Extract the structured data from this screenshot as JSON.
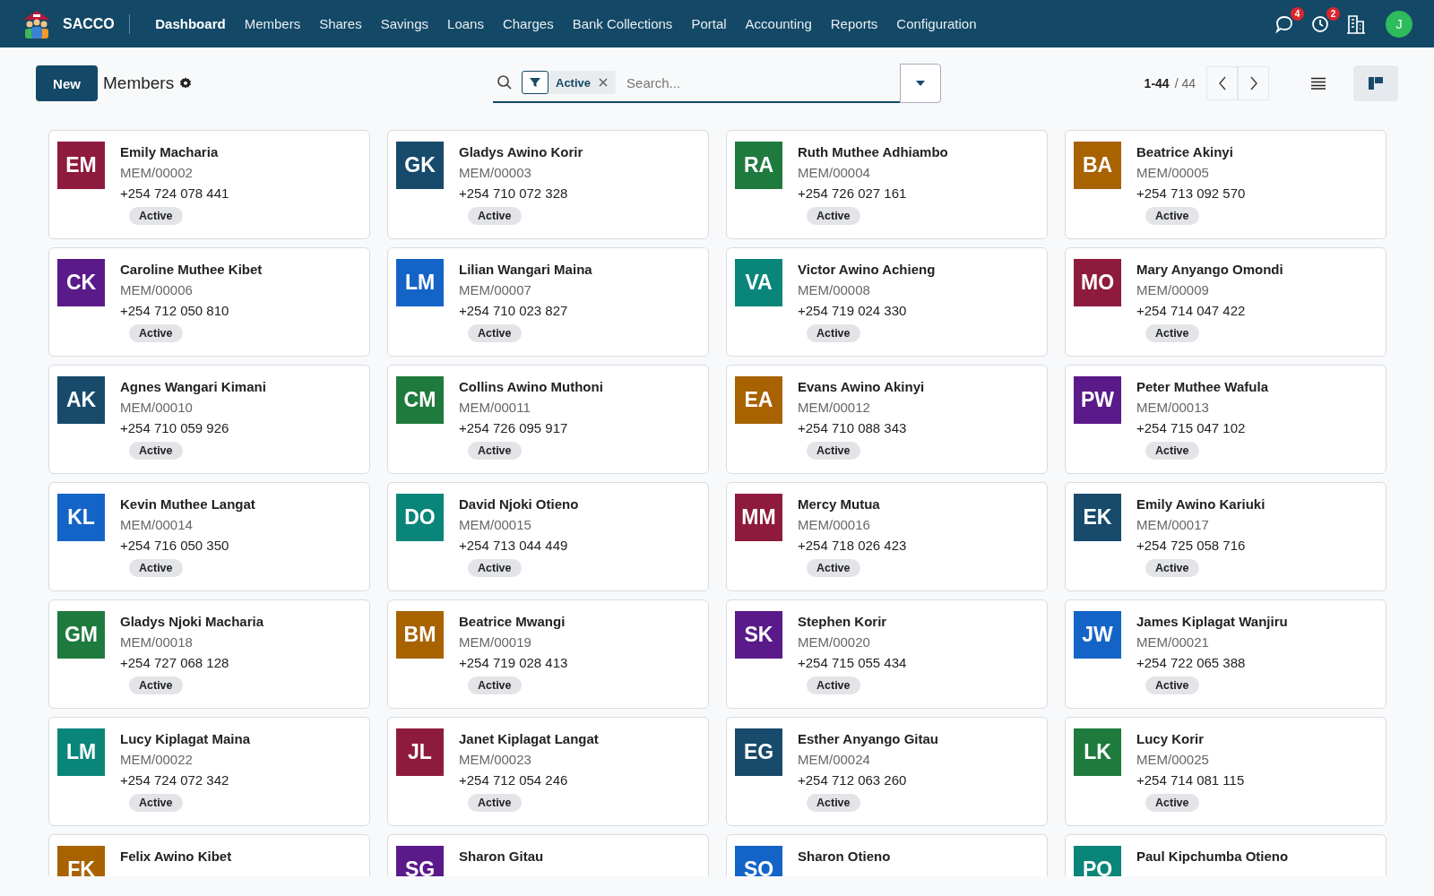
{
  "app": {
    "name": "SACCO"
  },
  "nav": [
    {
      "label": "Dashboard",
      "selected": true
    },
    {
      "label": "Members",
      "selected": false
    },
    {
      "label": "Shares",
      "selected": false
    },
    {
      "label": "Savings",
      "selected": false
    },
    {
      "label": "Loans",
      "selected": false
    },
    {
      "label": "Charges",
      "selected": false
    },
    {
      "label": "Bank Collections",
      "selected": false
    },
    {
      "label": "Portal",
      "selected": false
    },
    {
      "label": "Accounting",
      "selected": false
    },
    {
      "label": "Reports",
      "selected": false
    },
    {
      "label": "Configuration",
      "selected": false
    }
  ],
  "systray": {
    "messages_count": "4",
    "activities_count": "2",
    "user_initial": "J"
  },
  "control_panel": {
    "new_button": "New",
    "title": "Members",
    "facet": "Active",
    "search_placeholder": "Search...",
    "pager_range": "1-44",
    "pager_total": "/ 44",
    "view_buttons": [
      {
        "kind": "list",
        "selected": false
      },
      {
        "kind": "kanban",
        "selected": true
      }
    ]
  },
  "members": [
    {
      "initials": "EM",
      "name": "Emily Macharia",
      "id": "MEM/00002",
      "phone": "+254 724 078 441",
      "status": "Active",
      "color": "#8e1b3d"
    },
    {
      "initials": "GK",
      "name": "Gladys Awino Korir",
      "id": "MEM/00003",
      "phone": "+254 710 072 328",
      "status": "Active",
      "color": "#174a6b"
    },
    {
      "initials": "RA",
      "name": "Ruth Muthee Adhiambo",
      "id": "MEM/00004",
      "phone": "+254 726 027 161",
      "status": "Active",
      "color": "#1f7a3e"
    },
    {
      "initials": "BA",
      "name": "Beatrice Akinyi",
      "id": "MEM/00005",
      "phone": "+254 713 092 570",
      "status": "Active",
      "color": "#a86200"
    },
    {
      "initials": "CK",
      "name": "Caroline Muthee Kibet",
      "id": "MEM/00006",
      "phone": "+254 712 050 810",
      "status": "Active",
      "color": "#5a1a8a"
    },
    {
      "initials": "LM",
      "name": "Lilian Wangari Maina",
      "id": "MEM/00007",
      "phone": "+254 710 023 827",
      "status": "Active",
      "color": "#1464c8"
    },
    {
      "initials": "VA",
      "name": "Victor Awino Achieng",
      "id": "MEM/00008",
      "phone": "+254 719 024 330",
      "status": "Active",
      "color": "#0a857a"
    },
    {
      "initials": "MO",
      "name": "Mary Anyango Omondi",
      "id": "MEM/00009",
      "phone": "+254 714 047 422",
      "status": "Active",
      "color": "#8e1b3d"
    },
    {
      "initials": "AK",
      "name": "Agnes Wangari Kimani",
      "id": "MEM/00010",
      "phone": "+254 710 059 926",
      "status": "Active",
      "color": "#174a6b"
    },
    {
      "initials": "CM",
      "name": "Collins Awino Muthoni",
      "id": "MEM/00011",
      "phone": "+254 726 095 917",
      "status": "Active",
      "color": "#1f7a3e"
    },
    {
      "initials": "EA",
      "name": "Evans Awino Akinyi",
      "id": "MEM/00012",
      "phone": "+254 710 088 343",
      "status": "Active",
      "color": "#a86200"
    },
    {
      "initials": "PW",
      "name": "Peter Muthee Wafula",
      "id": "MEM/00013",
      "phone": "+254 715 047 102",
      "status": "Active",
      "color": "#5a1a8a"
    },
    {
      "initials": "KL",
      "name": "Kevin Muthee Langat",
      "id": "MEM/00014",
      "phone": "+254 716 050 350",
      "status": "Active",
      "color": "#1464c8"
    },
    {
      "initials": "DO",
      "name": "David Njoki Otieno",
      "id": "MEM/00015",
      "phone": "+254 713 044 449",
      "status": "Active",
      "color": "#0a857a"
    },
    {
      "initials": "MM",
      "name": "Mercy Mutua",
      "id": "MEM/00016",
      "phone": "+254 718 026 423",
      "status": "Active",
      "color": "#8e1b3d"
    },
    {
      "initials": "EK",
      "name": "Emily Awino Kariuki",
      "id": "MEM/00017",
      "phone": "+254 725 058 716",
      "status": "Active",
      "color": "#174a6b"
    },
    {
      "initials": "GM",
      "name": "Gladys Njoki Macharia",
      "id": "MEM/00018",
      "phone": "+254 727 068 128",
      "status": "Active",
      "color": "#1f7a3e"
    },
    {
      "initials": "BM",
      "name": "Beatrice Mwangi",
      "id": "MEM/00019",
      "phone": "+254 719 028 413",
      "status": "Active",
      "color": "#a86200"
    },
    {
      "initials": "SK",
      "name": "Stephen Korir",
      "id": "MEM/00020",
      "phone": "+254 715 055 434",
      "status": "Active",
      "color": "#5a1a8a"
    },
    {
      "initials": "JW",
      "name": "James Kiplagat Wanjiru",
      "id": "MEM/00021",
      "phone": "+254 722 065 388",
      "status": "Active",
      "color": "#1464c8"
    },
    {
      "initials": "LM",
      "name": "Lucy Kiplagat Maina",
      "id": "MEM/00022",
      "phone": "+254 724 072 342",
      "status": "Active",
      "color": "#0a857a"
    },
    {
      "initials": "JL",
      "name": "Janet Kiplagat Langat",
      "id": "MEM/00023",
      "phone": "+254 712 054 246",
      "status": "Active",
      "color": "#8e1b3d"
    },
    {
      "initials": "EG",
      "name": "Esther Anyango Gitau",
      "id": "MEM/00024",
      "phone": "+254 712 063 260",
      "status": "Active",
      "color": "#174a6b"
    },
    {
      "initials": "LK",
      "name": "Lucy Korir",
      "id": "MEM/00025",
      "phone": "+254 714 081 115",
      "status": "Active",
      "color": "#1f7a3e"
    },
    {
      "initials": "FK",
      "name": "Felix Awino Kibet",
      "color": "#a86200"
    },
    {
      "initials": "SG",
      "name": "Sharon Gitau",
      "color": "#5a1a8a"
    },
    {
      "initials": "SO",
      "name": "Sharon Otieno",
      "color": "#1464c8"
    },
    {
      "initials": "PO",
      "name": "Paul Kipchumba Otieno",
      "color": "#0a857a"
    }
  ]
}
